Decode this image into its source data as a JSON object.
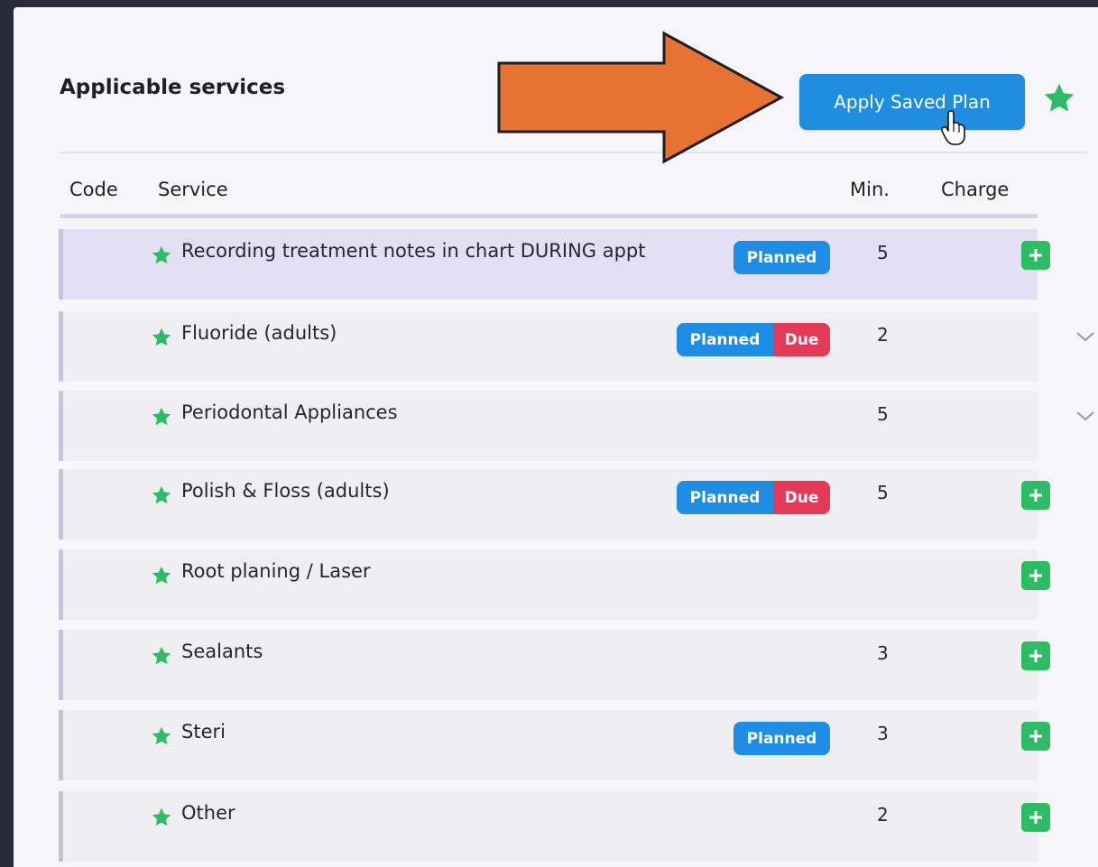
{
  "header": {
    "title": "Applicable services",
    "apply_button_label": "Apply Saved Plan"
  },
  "columns": {
    "code": "Code",
    "service": "Service",
    "min": "Min.",
    "charge": "Charge"
  },
  "services": [
    {
      "name": "Recording treatment notes in chart DURING appt",
      "badges": [
        "Planned"
      ],
      "min": "5",
      "action": "add"
    },
    {
      "name": "Fluoride (adults)",
      "badges": [
        "Planned",
        "Due"
      ],
      "min": "2",
      "action": "expand"
    },
    {
      "name": "Periodontal Appliances",
      "badges": [],
      "min": "5",
      "action": "expand"
    },
    {
      "name": "Polish & Floss (adults)",
      "badges": [
        "Planned",
        "Due"
      ],
      "min": "5",
      "action": "add"
    },
    {
      "name": "Root planing / Laser",
      "badges": [],
      "min": "",
      "action": "add"
    },
    {
      "name": "Sealants",
      "badges": [],
      "min": "3",
      "action": "add"
    },
    {
      "name": "Steri",
      "badges": [
        "Planned"
      ],
      "min": "3",
      "action": "add"
    },
    {
      "name": "Other",
      "badges": [],
      "min": "2",
      "action": "add"
    }
  ],
  "icons": {
    "favorite": "star-icon",
    "add": "plus-icon",
    "expand": "chevron-down-icon",
    "annotation": "arrow-right-icon",
    "cursor": "hand-pointer-icon"
  },
  "colors": {
    "primary": "#1f8ee0",
    "planned_badge": "#1d8de6",
    "due_badge": "#e33a58",
    "add_button": "#2cbc63",
    "star": "#2cbc63",
    "highlight_row": "#e3e0f6",
    "annotation_arrow": "#e87232"
  }
}
